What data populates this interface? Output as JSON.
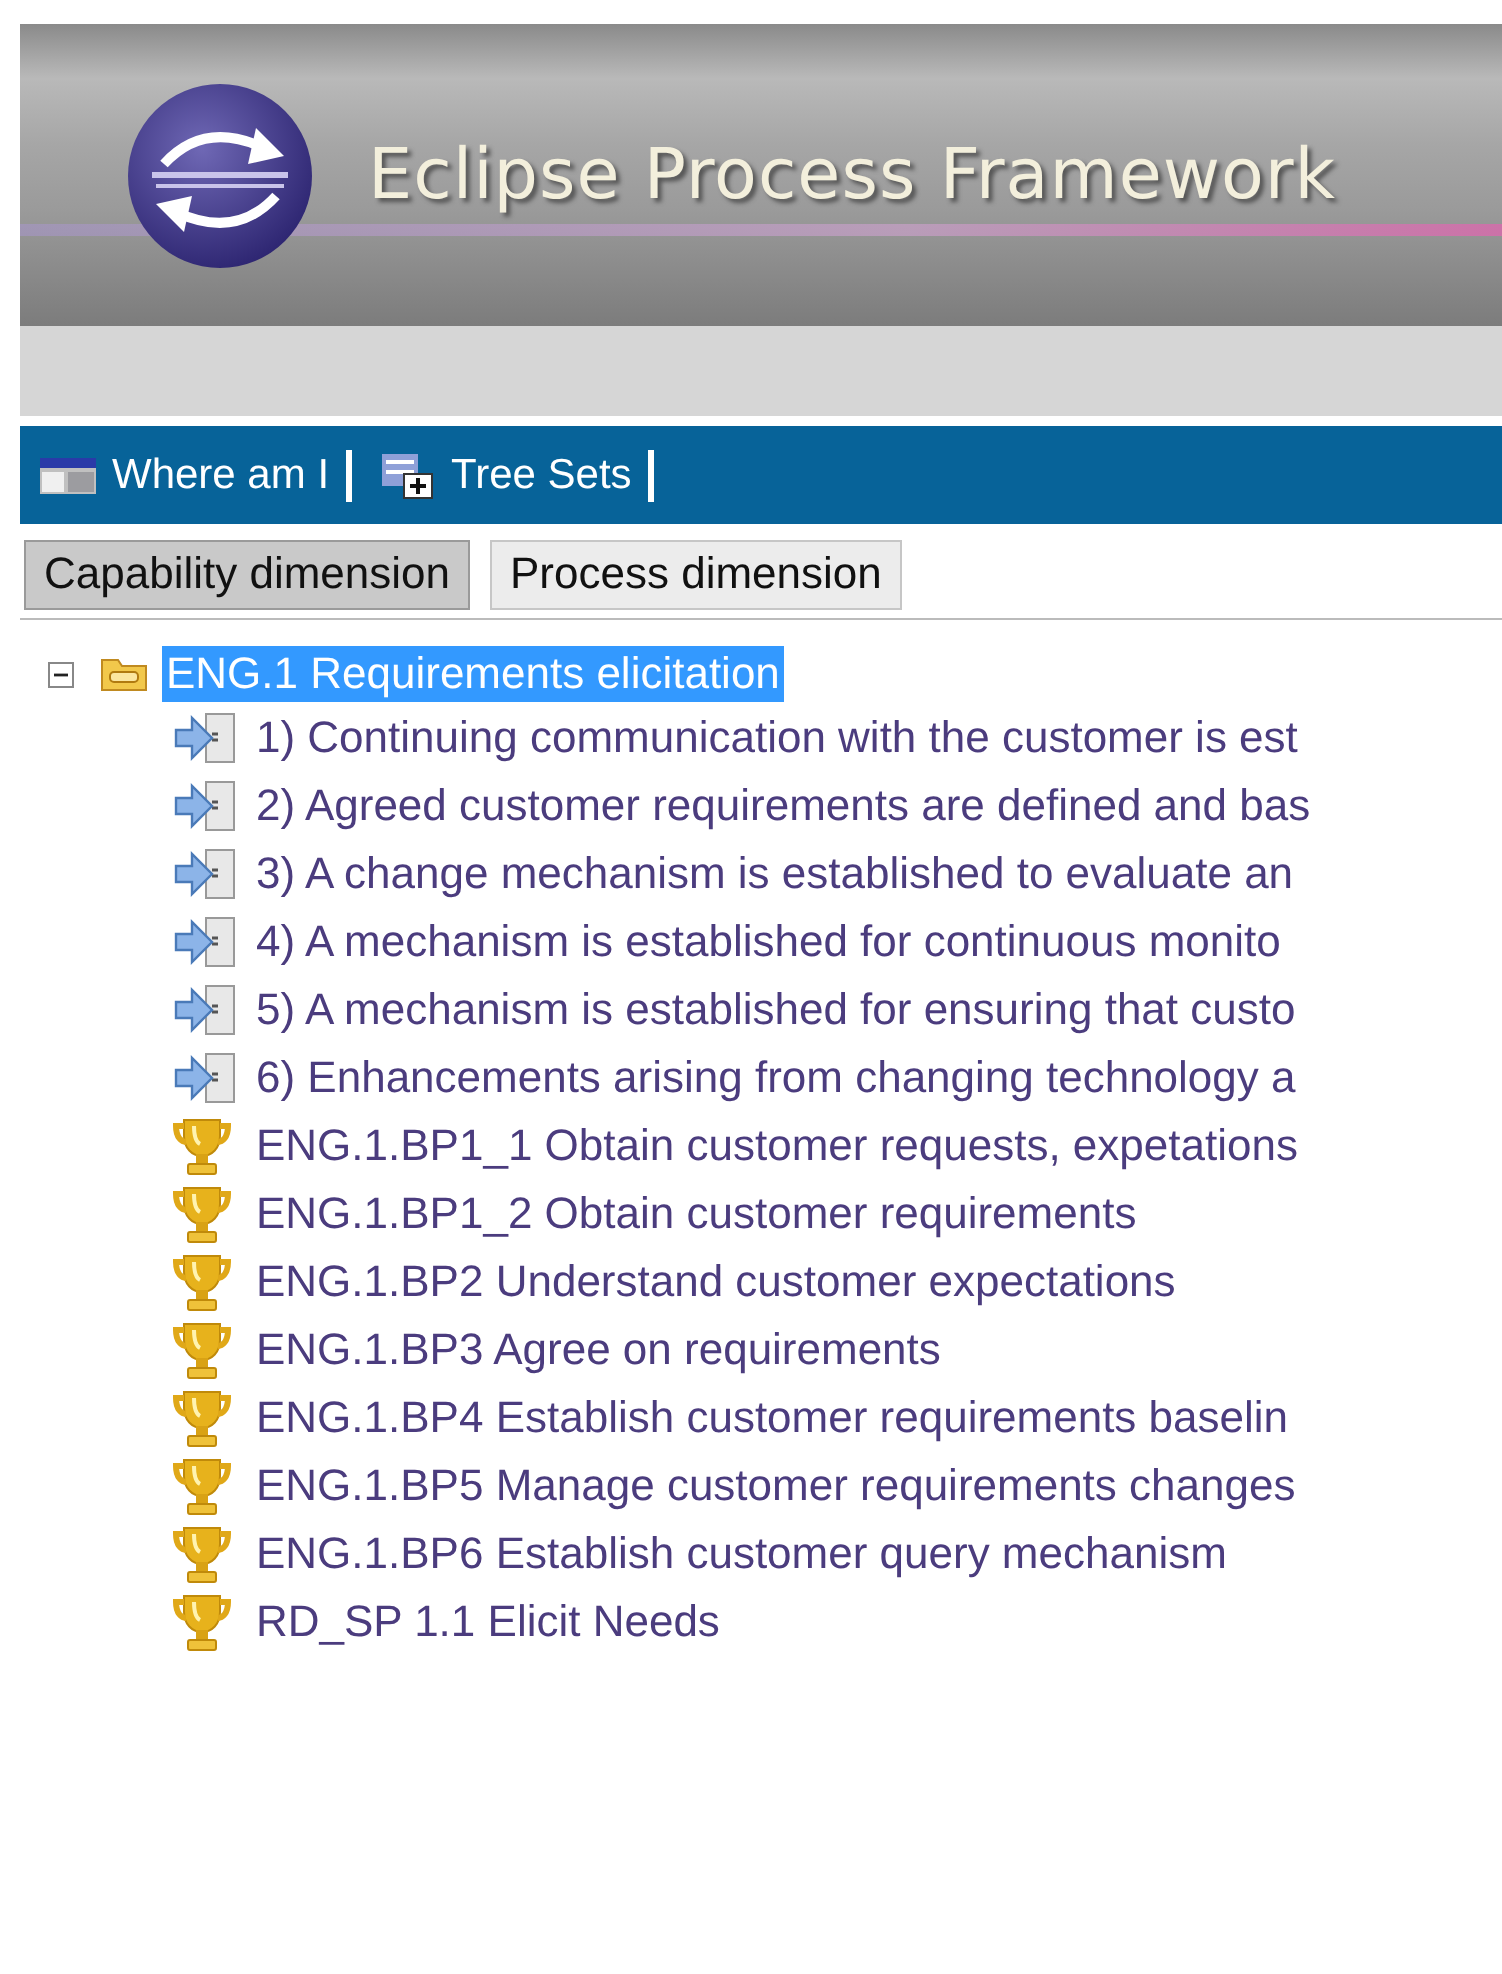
{
  "header": {
    "title": "Eclipse Process Framework"
  },
  "toolbar": {
    "links": [
      {
        "kind": "where",
        "label": "Where am I"
      },
      {
        "kind": "treesets",
        "label": "Tree Sets"
      }
    ]
  },
  "tabs": [
    {
      "label": "Capability dimension",
      "selected": true
    },
    {
      "label": "Process dimension",
      "selected": false
    }
  ],
  "tree": {
    "root": {
      "label": "ENG.1 Requirements elicitation",
      "expanded": true,
      "selected": true,
      "children": [
        {
          "kind": "outcome",
          "label": "1) Continuing communication with the customer is est"
        },
        {
          "kind": "outcome",
          "label": "2) Agreed customer requirements are defined and bas"
        },
        {
          "kind": "outcome",
          "label": "3) A change mechanism is established to evaluate an"
        },
        {
          "kind": "outcome",
          "label": "4) A mechanism is established for continuous monito"
        },
        {
          "kind": "outcome",
          "label": "5) A mechanism is established for ensuring that custo"
        },
        {
          "kind": "outcome",
          "label": "6) Enhancements arising from changing technology a"
        },
        {
          "kind": "practice",
          "label": "ENG.1.BP1_1 Obtain customer requests, expetations"
        },
        {
          "kind": "practice",
          "label": "ENG.1.BP1_2 Obtain customer requirements"
        },
        {
          "kind": "practice",
          "label": "ENG.1.BP2 Understand customer expectations"
        },
        {
          "kind": "practice",
          "label": "ENG.1.BP3 Agree on requirements"
        },
        {
          "kind": "practice",
          "label": "ENG.1.BP4 Establish customer requirements baselin"
        },
        {
          "kind": "practice",
          "label": "ENG.1.BP5 Manage customer requirements changes"
        },
        {
          "kind": "practice",
          "label": "ENG.1.BP6 Establish customer query mechanism"
        },
        {
          "kind": "practice",
          "label": "RD_SP 1.1 Elicit Needs"
        }
      ]
    }
  }
}
